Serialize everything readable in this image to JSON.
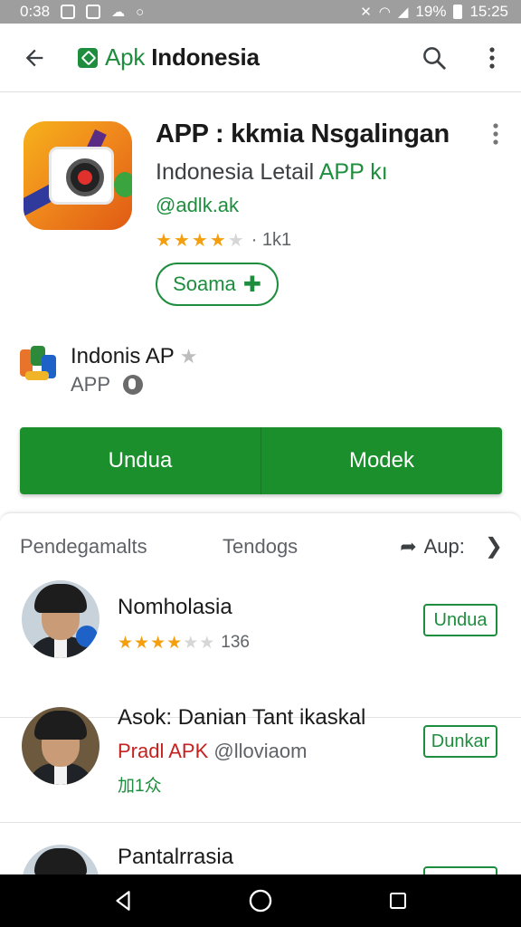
{
  "status_bar": {
    "time": "0:38",
    "battery_text": "19%",
    "clock": "15:25"
  },
  "app_bar": {
    "brand_prefix": "Apk",
    "brand_suffix": "Indonesia",
    "back_icon": "arrow-left-icon",
    "search_icon": "search-icon",
    "more_icon": "more-vert-icon",
    "accent_color": "#1e8e3e"
  },
  "app": {
    "title": "APP : kkmia Nsgalingan",
    "subtitle_dark": "Indonesia Letail",
    "subtitle_green": "APP kı",
    "handle": "@adlk.ak",
    "rating_stars": 4.5,
    "rating_count": "· 1k1",
    "follow_label": "Soama"
  },
  "developer": {
    "name": "Indonis AP",
    "type": "APP"
  },
  "actions": {
    "primary_label": "Undua",
    "secondary_label": "Modek"
  },
  "tabs": {
    "tab1": "Pendegamalts",
    "tab2": "Tendogs",
    "tab3": "Aup:"
  },
  "items": [
    {
      "title": "Nomholasia",
      "rating_stars": 3.5,
      "count": "136",
      "button": "Undua"
    },
    {
      "title": "Asok: Danian Tant ikaskal",
      "sub_red": "Pradl APK",
      "sub_gray": "@lloviaom",
      "meta": "加1众",
      "button": "Dunkar"
    },
    {
      "title": "Pantalrrasia"
    }
  ],
  "nav": {
    "back_icon": "nav-back-icon",
    "home_icon": "nav-home-icon",
    "recents_icon": "nav-recents-icon"
  }
}
